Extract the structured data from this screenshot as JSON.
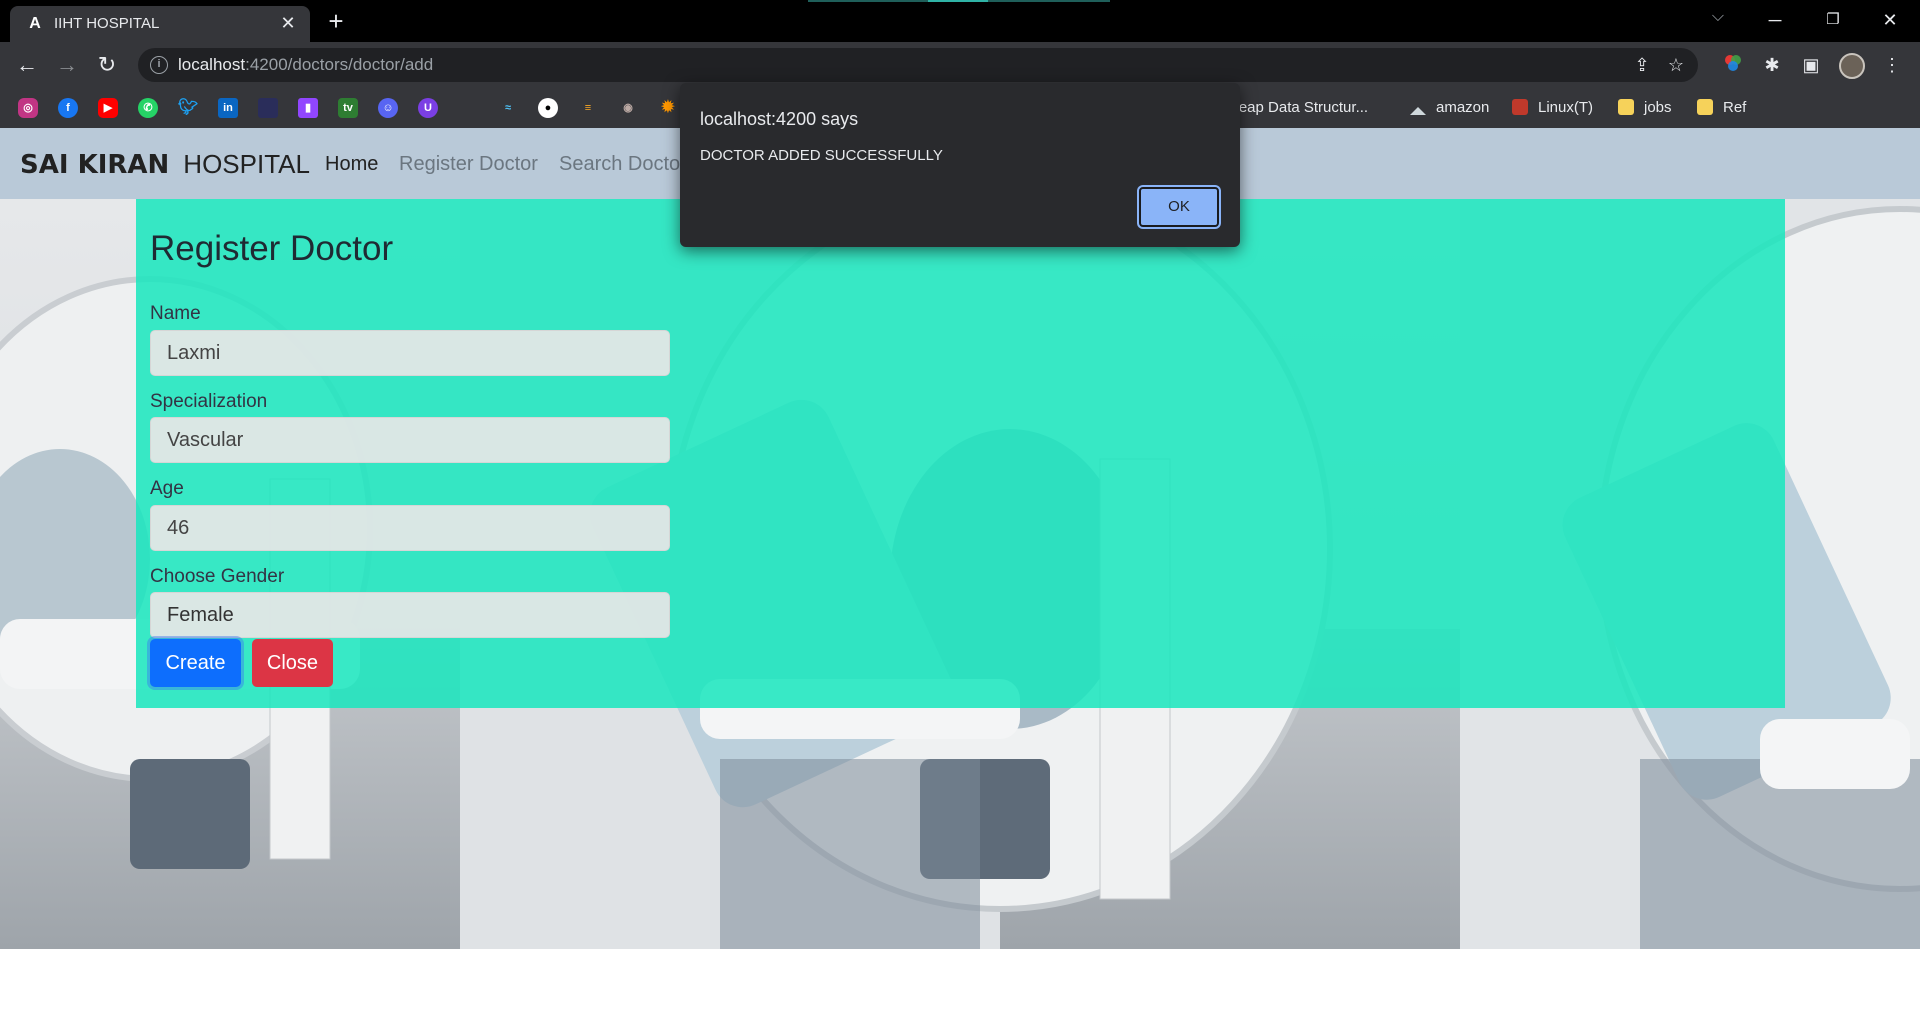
{
  "browser": {
    "tab_title": "IIHT HOSPITAL",
    "tab_favicon": "A",
    "url_host": "localhost",
    "url_rest": ":4200/doctors/doctor/add",
    "bookmarks": [
      {
        "label": "Heap Data Structur...",
        "icon": "heap-icon"
      },
      {
        "label": "amazon",
        "icon": "amazon-icon"
      },
      {
        "label": "Linux(T)",
        "icon": "linux-icon"
      },
      {
        "label": "jobs",
        "icon": "folder-icon"
      },
      {
        "label": "Ref",
        "icon": "folder-icon"
      }
    ],
    "bookmark_icons": [
      "instagram-icon",
      "facebook-icon",
      "youtube-icon",
      "whatsapp-icon",
      "twitter-icon",
      "linkedin-icon",
      "bookmark-icon",
      "twitch-icon",
      "tv-icon",
      "discord-icon",
      "u-icon",
      "wave-icon",
      "github-icon",
      "app-icon",
      "owl-icon",
      "sun-icon"
    ]
  },
  "app": {
    "brand_primary": "SAI KIRAN",
    "brand_secondary": "HOSPITAL",
    "nav": {
      "home": "Home",
      "register": "Register Doctor",
      "search": "Search Doctor"
    }
  },
  "form": {
    "title": "Register Doctor",
    "name_label": "Name",
    "name_value": "Laxmi",
    "specialization_label": "Specialization",
    "specialization_value": "Vascular",
    "age_label": "Age",
    "age_value": "46",
    "gender_label": "Choose Gender",
    "gender_value": "Female",
    "create_label": "Create",
    "close_label": "Close"
  },
  "dialog": {
    "title": "localhost:4200 says",
    "message": "DOCTOR ADDED SUCCESSFULLY",
    "ok_label": "OK"
  },
  "colors": {
    "panel": "#18e6be",
    "primary": "#0d6efd",
    "danger": "#dc3545",
    "dialog_button": "#8ab4f8"
  }
}
